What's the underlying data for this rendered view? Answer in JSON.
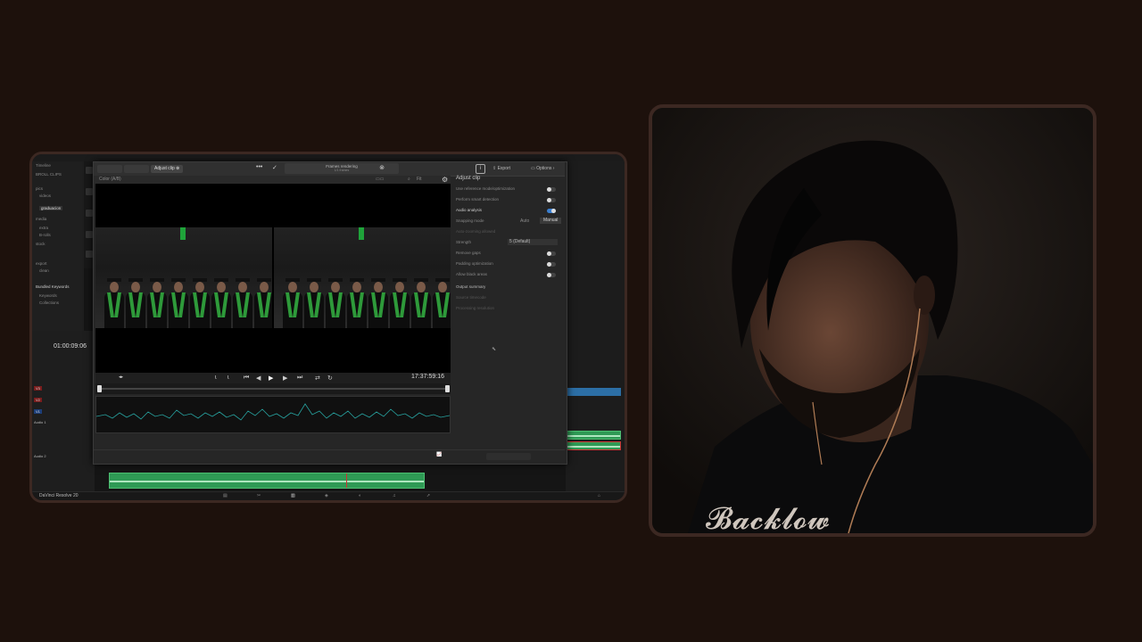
{
  "resolve": {
    "dialog": {
      "tab_label": "Adjust clip",
      "status_title": "Frames rendering",
      "status_sub": "1/1 frames",
      "export_label": "Export",
      "options_label": "Options",
      "viewer_label": "Color (A/B)",
      "zoom": "Fit"
    },
    "viewer": {
      "timecode": "17:37:59:16"
    },
    "settings": {
      "header": "Adjust clip",
      "rows": [
        {
          "label": "Use reference mode/optimization"
        },
        {
          "label": "Perform smart detection"
        },
        {
          "label": "Audio analysis"
        },
        {
          "label": "Snapping mode"
        },
        {
          "label": "Auto-zooming allowed"
        },
        {
          "label": "Strength"
        },
        {
          "label": "Remove gaps"
        },
        {
          "label": "Padding optimization"
        },
        {
          "label": "Allow black areas"
        },
        {
          "label": "Output summary"
        },
        {
          "label": "Source timecode"
        },
        {
          "label": "Processing resolution"
        }
      ],
      "snapping_options": [
        "Auto",
        "Manual"
      ],
      "strength_value": "5 (Default)"
    },
    "timeline": {
      "timecode": "01:00:09:06",
      "tracks": [
        "V3",
        "V2",
        "V1",
        "A1",
        "A2"
      ],
      "audio1_label": "Audio 1",
      "audio2_label": "Audio 2"
    },
    "media_tree": [
      "Timeline",
      "BROLL CLIPS",
      "pics",
      "videos",
      "graduacion",
      "media",
      "extra",
      "B-rolls",
      "stock",
      "export",
      "clean",
      "Bundled Keywords",
      "Keywords",
      "Collections"
    ],
    "statusbar": {
      "app_name": "DaVinci Resolve 20"
    }
  },
  "colors": {
    "background": "#1d110c",
    "frame_border": "#3c2822",
    "accent_blue": "#3a7fd0",
    "audio_green": "#2f9a55",
    "stole_green": "#2e9a3a"
  }
}
